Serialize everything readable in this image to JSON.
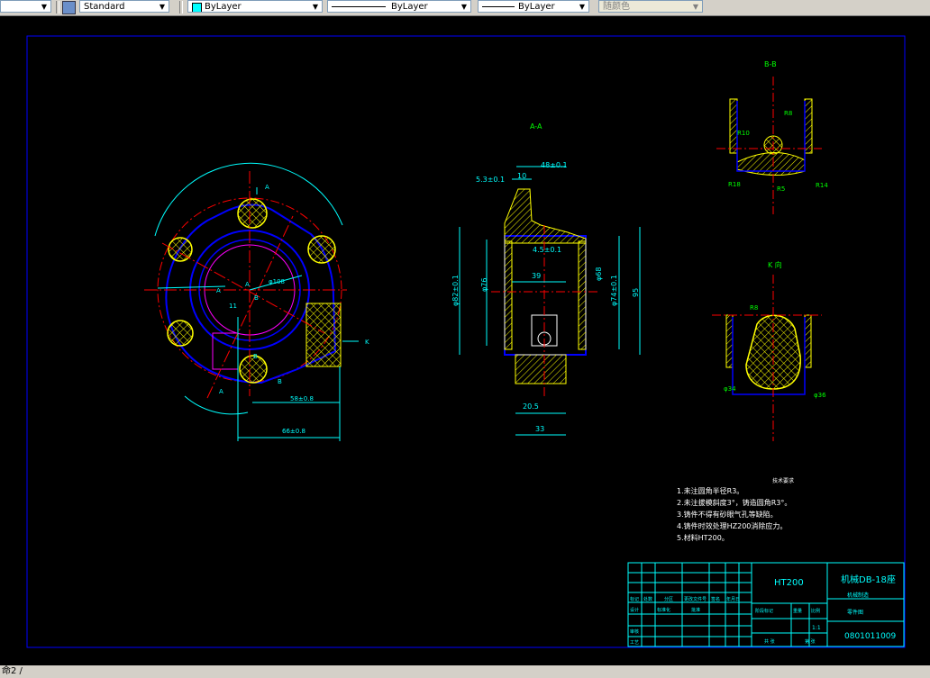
{
  "toolbar": {
    "text_style": "Standard",
    "layer_color": "ByLayer",
    "linetype": "ByLayer",
    "lineweight": "ByLayer",
    "plot_style": "随颜色",
    "layer_color_swatch": "#00ffff"
  },
  "command_line": "命2 /",
  "drawing": {
    "views": {
      "section_aa": "A-A",
      "section_bb": "B-B",
      "view_k": "K 向"
    },
    "dims": {
      "d48": "48±0.1",
      "d10": "10",
      "d53": "5.3±0.1",
      "d45": "4.5±0.1",
      "d39": "39",
      "d76": "φ76",
      "d68": "φ68",
      "d82": "φ82±0.1",
      "d74": "φ74±0.1",
      "d95": "95",
      "d205": "20.5",
      "d33": "33",
      "d58": "58±0.8",
      "d66": "66±0.8",
      "d108": "φ108",
      "d11": "11",
      "r10": "R10",
      "r8": "R8",
      "r18": "R18",
      "r5": "R5",
      "r14": "R14",
      "r8k": "R8",
      "d34": "φ34",
      "d36": "φ36"
    },
    "letters": {
      "a": "A",
      "b": "B",
      "k": "K"
    },
    "notes_title": "技术要求",
    "notes": [
      "1.未注圆角半径R3。",
      "2.未注拔模斜度3°，铸造圆角R3°。",
      "3.铸件不得有砂眼气孔等缺陷。",
      "4.铸件时效处理HZ200消除应力。",
      "5.材料HT200。"
    ],
    "title_block": {
      "material": "HT200",
      "part_name": "机械DB-18座",
      "company": "机械制造",
      "subtitle": "零件图",
      "scale": "1:1",
      "drawing_no": "0801011009",
      "col_labels": [
        "标记",
        "处数",
        "分区",
        "更改文件号",
        "签名",
        "年月日"
      ],
      "row_labels": [
        "设计",
        "审核",
        "工艺"
      ],
      "cells": [
        "标准化",
        "批准",
        "阶段标记",
        "重量",
        "比例",
        "共 张",
        "第 张"
      ]
    }
  }
}
